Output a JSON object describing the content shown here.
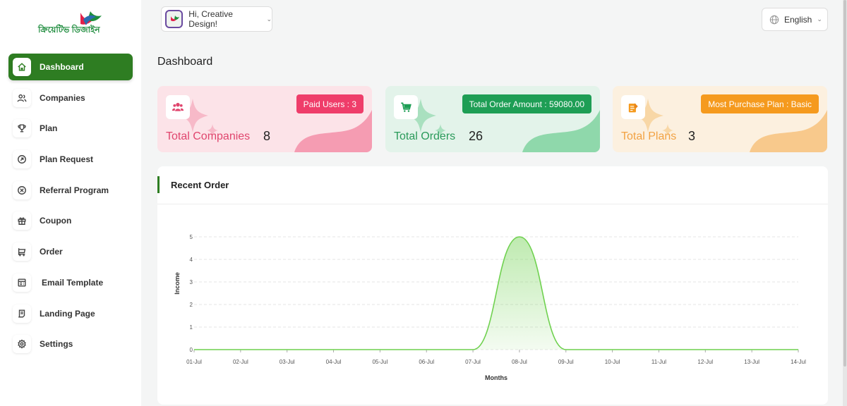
{
  "brand": {
    "logo_text": "ক্রিয়েটিভ ডিজাইন",
    "accent": "#2e7d22"
  },
  "sidebar": {
    "items": [
      {
        "label": "Dashboard",
        "icon": "home-icon",
        "active": true
      },
      {
        "label": "Companies",
        "icon": "users-icon"
      },
      {
        "label": "Plan",
        "icon": "trophy-icon"
      },
      {
        "label": "Plan Request",
        "icon": "arrow-circle-icon"
      },
      {
        "label": "Referral Program",
        "icon": "referral-icon"
      },
      {
        "label": "Coupon",
        "icon": "gift-icon"
      },
      {
        "label": "Order",
        "icon": "cart-icon"
      },
      {
        "label": "Email Template",
        "icon": "template-icon"
      },
      {
        "label": "Landing Page",
        "icon": "page-icon"
      },
      {
        "label": "Settings",
        "icon": "gear-icon"
      }
    ]
  },
  "header": {
    "greeting": "Hi, Creative Design!",
    "language": "English"
  },
  "page": {
    "title": "Dashboard"
  },
  "cards": [
    {
      "label": "Total Companies",
      "value": "8",
      "badge": "Paid Users : 3",
      "color": "#ef3d6a",
      "icon": "users-icon"
    },
    {
      "label": "Total Orders",
      "value": "26",
      "badge": "Total Order Amount : 59080.00",
      "color": "#1e9e55",
      "icon": "cart-icon"
    },
    {
      "label": "Total Plans",
      "value": "3",
      "badge": "Most Purchase Plan : Basic",
      "color": "#f59a1e",
      "icon": "plan-icon"
    }
  ],
  "recent_order": {
    "title": "Recent Order"
  },
  "chart_data": {
    "type": "area",
    "categories": [
      "01-Jul",
      "02-Jul",
      "03-Jul",
      "04-Jul",
      "05-Jul",
      "06-Jul",
      "07-Jul",
      "08-Jul",
      "09-Jul",
      "10-Jul",
      "11-Jul",
      "12-Jul",
      "13-Jul",
      "14-Jul"
    ],
    "values": [
      0,
      0,
      0,
      0,
      0,
      0,
      0,
      5,
      0,
      0,
      0,
      0,
      0,
      0
    ],
    "title": "",
    "xlabel": "Months",
    "ylabel": "Income",
    "ylim": [
      0,
      5
    ],
    "yticks": [
      0,
      1,
      2,
      3,
      4,
      5
    ],
    "grid": true,
    "color": "#6fd14f"
  }
}
